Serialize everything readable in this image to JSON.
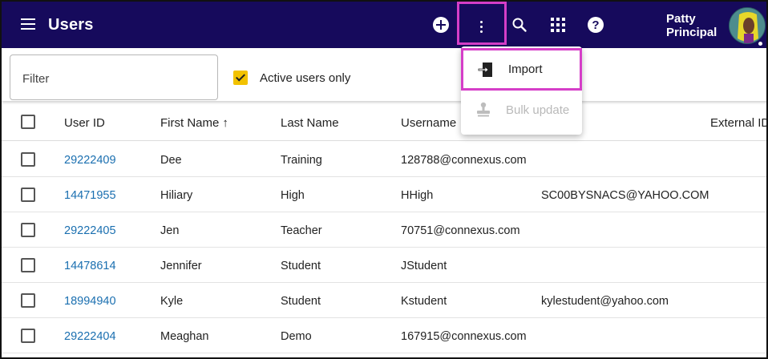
{
  "header": {
    "title": "Users",
    "user_name_line1": "Patty",
    "user_name_line2": "Principal",
    "icons": [
      "menu-icon",
      "add-icon",
      "more-vert-icon",
      "search-icon",
      "apps-icon",
      "help-icon"
    ]
  },
  "filter": {
    "placeholder": "Filter",
    "active_only_label": "Active users only",
    "active_only_checked": true
  },
  "menu": {
    "items": [
      {
        "label": "Import",
        "icon": "import-icon",
        "enabled": true
      },
      {
        "label": "Bulk update",
        "icon": "stamp-icon",
        "enabled": false
      }
    ]
  },
  "table": {
    "columns": [
      "User ID",
      "First Name",
      "Last Name",
      "Username",
      "",
      "External ID"
    ],
    "sort_indicator": "↑",
    "rows": [
      {
        "user_id": "29222409",
        "first": "Dee",
        "last": "Training",
        "username": "128788@connexus.com",
        "email": ""
      },
      {
        "user_id": "14471955",
        "first": "Hiliary",
        "last": "High",
        "username": "HHigh",
        "email": "SC00BYSNACS@YAHOO.COM"
      },
      {
        "user_id": "29222405",
        "first": "Jen",
        "last": "Teacher",
        "username": "70751@connexus.com",
        "email": ""
      },
      {
        "user_id": "14478614",
        "first": "Jennifer",
        "last": "Student",
        "username": "JStudent",
        "email": ""
      },
      {
        "user_id": "18994940",
        "first": "Kyle",
        "last": "Student",
        "username": "Kstudent",
        "email": "kylestudent@yahoo.com"
      },
      {
        "user_id": "29222404",
        "first": "Meaghan",
        "last": "Demo",
        "username": "167915@connexus.com",
        "email": ""
      }
    ]
  },
  "colors": {
    "topbar": "#160a5c",
    "highlight": "#d53ec8",
    "link": "#1a6fb0",
    "checkbox_active": "#f2c200"
  }
}
